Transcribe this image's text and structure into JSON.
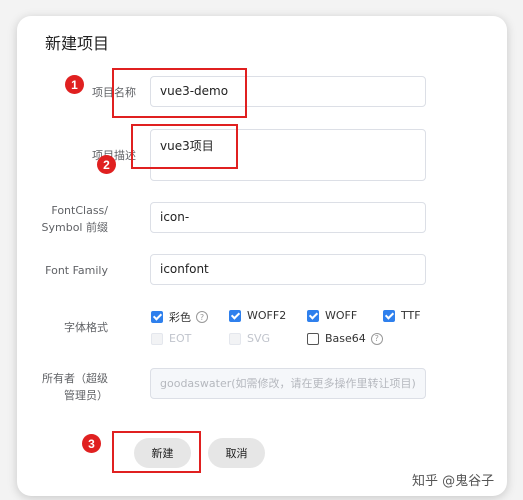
{
  "dialog": {
    "title": "新建项目",
    "fields": {
      "name": {
        "label": "项目名称",
        "value": "vue3-demo"
      },
      "desc": {
        "label": "项目描述",
        "value": "vue3项目"
      },
      "fontclass": {
        "label_line1": "FontClass/",
        "label_line2": "Symbol 前缀",
        "value": "icon-"
      },
      "fontfamily": {
        "label": "Font Family",
        "value": "iconfont"
      },
      "formats": {
        "label": "字体格式",
        "options": [
          {
            "label": "彩色",
            "checked": true,
            "help": "?"
          },
          {
            "label": "WOFF2",
            "checked": true
          },
          {
            "label": "WOFF",
            "checked": true
          },
          {
            "label": "TTF",
            "checked": true
          },
          {
            "label": "EOT",
            "checked": false,
            "disabled": true
          },
          {
            "label": "SVG",
            "checked": false,
            "disabled": true
          },
          {
            "label": "Base64",
            "checked": false,
            "help": "?"
          }
        ]
      },
      "owner": {
        "label_line1": "所有者（超级",
        "label_line2": "管理员）",
        "placeholder": "goodaswater(如需修改，请在更多操作里转让项目)"
      }
    },
    "buttons": {
      "create": "新建",
      "cancel": "取消"
    }
  },
  "annotations": [
    "1",
    "2",
    "3"
  ],
  "watermark": "知乎 @鬼谷子",
  "colors": {
    "accent": "#2f80ed",
    "annotation": "#e02020"
  }
}
